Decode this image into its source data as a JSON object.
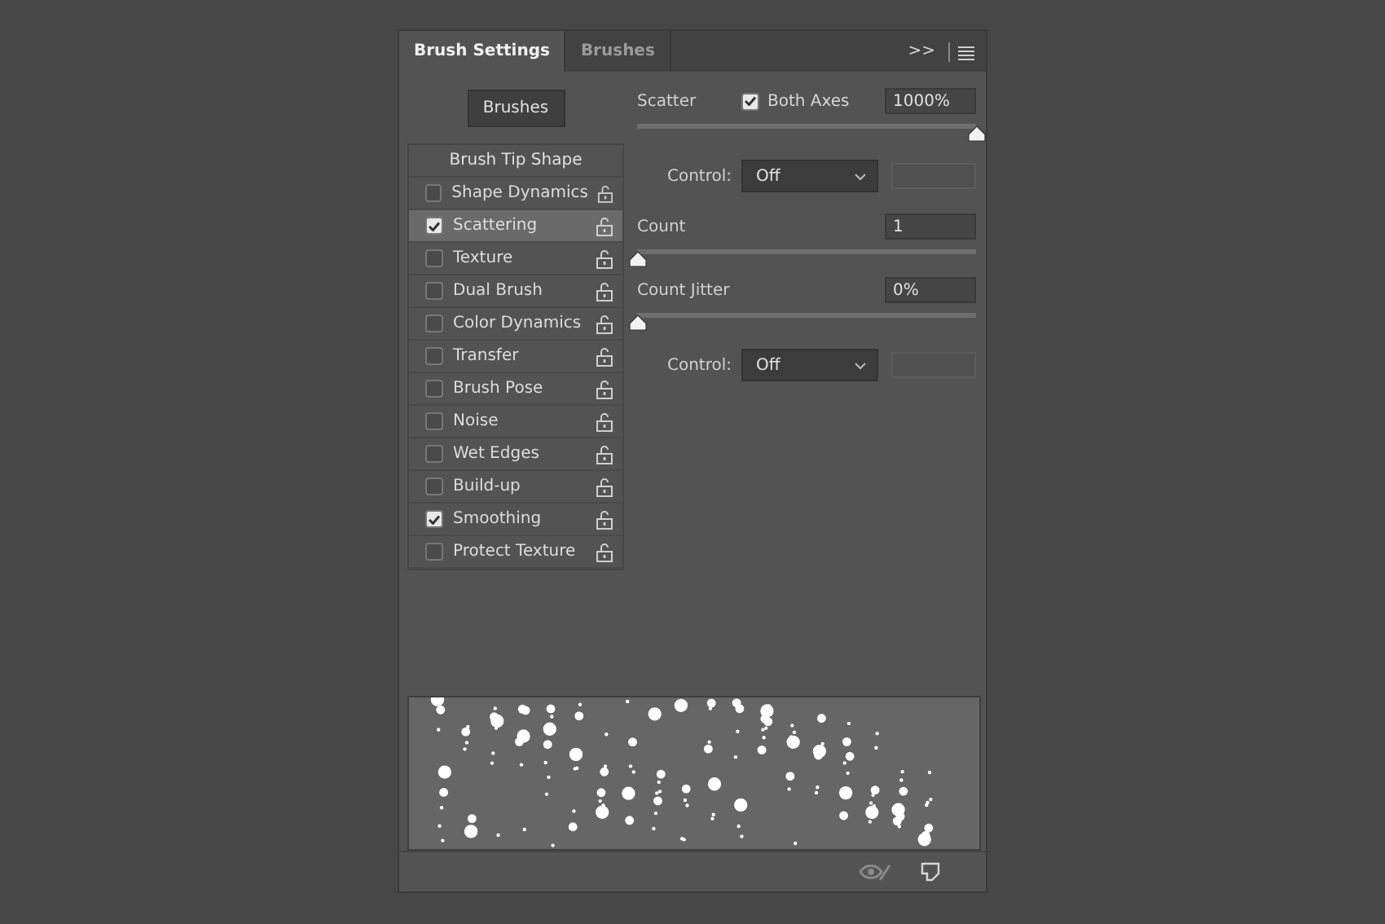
{
  "tabs": [
    {
      "label": "Brush Settings",
      "selected": true
    },
    {
      "label": "Brushes",
      "selected": false
    }
  ],
  "header_icons": {
    "expand": ">>"
  },
  "brushes_button": "Brushes",
  "tip_shape": "Brush Tip Shape",
  "options": [
    {
      "label": "Shape Dynamics",
      "checked": false,
      "selected": false
    },
    {
      "label": "Scattering",
      "checked": true,
      "selected": true
    },
    {
      "label": "Texture",
      "checked": false,
      "selected": false
    },
    {
      "label": "Dual Brush",
      "checked": false,
      "selected": false
    },
    {
      "label": "Color Dynamics",
      "checked": false,
      "selected": false
    },
    {
      "label": "Transfer",
      "checked": false,
      "selected": false
    },
    {
      "label": "Brush Pose",
      "checked": false,
      "selected": false
    },
    {
      "label": "Noise",
      "checked": false,
      "selected": false
    },
    {
      "label": "Wet Edges",
      "checked": false,
      "selected": false
    },
    {
      "label": "Build-up",
      "checked": false,
      "selected": false
    },
    {
      "label": "Smoothing",
      "checked": true,
      "selected": false
    },
    {
      "label": "Protect Texture",
      "checked": false,
      "selected": false
    }
  ],
  "settings": [
    {
      "kind": "slider",
      "label": "Scatter",
      "checkbox": {
        "label": "Both Axes",
        "checked": true
      },
      "value": "1000%",
      "level": 1
    },
    {
      "kind": "control",
      "label": "Control:",
      "value": "Off"
    },
    {
      "kind": "slider",
      "label": "Count",
      "value": "1",
      "level": 0
    },
    {
      "kind": "slider",
      "label": "Count Jitter",
      "value": "0%",
      "level": 0
    },
    {
      "kind": "control",
      "label": "Control:",
      "value": "Off"
    }
  ]
}
